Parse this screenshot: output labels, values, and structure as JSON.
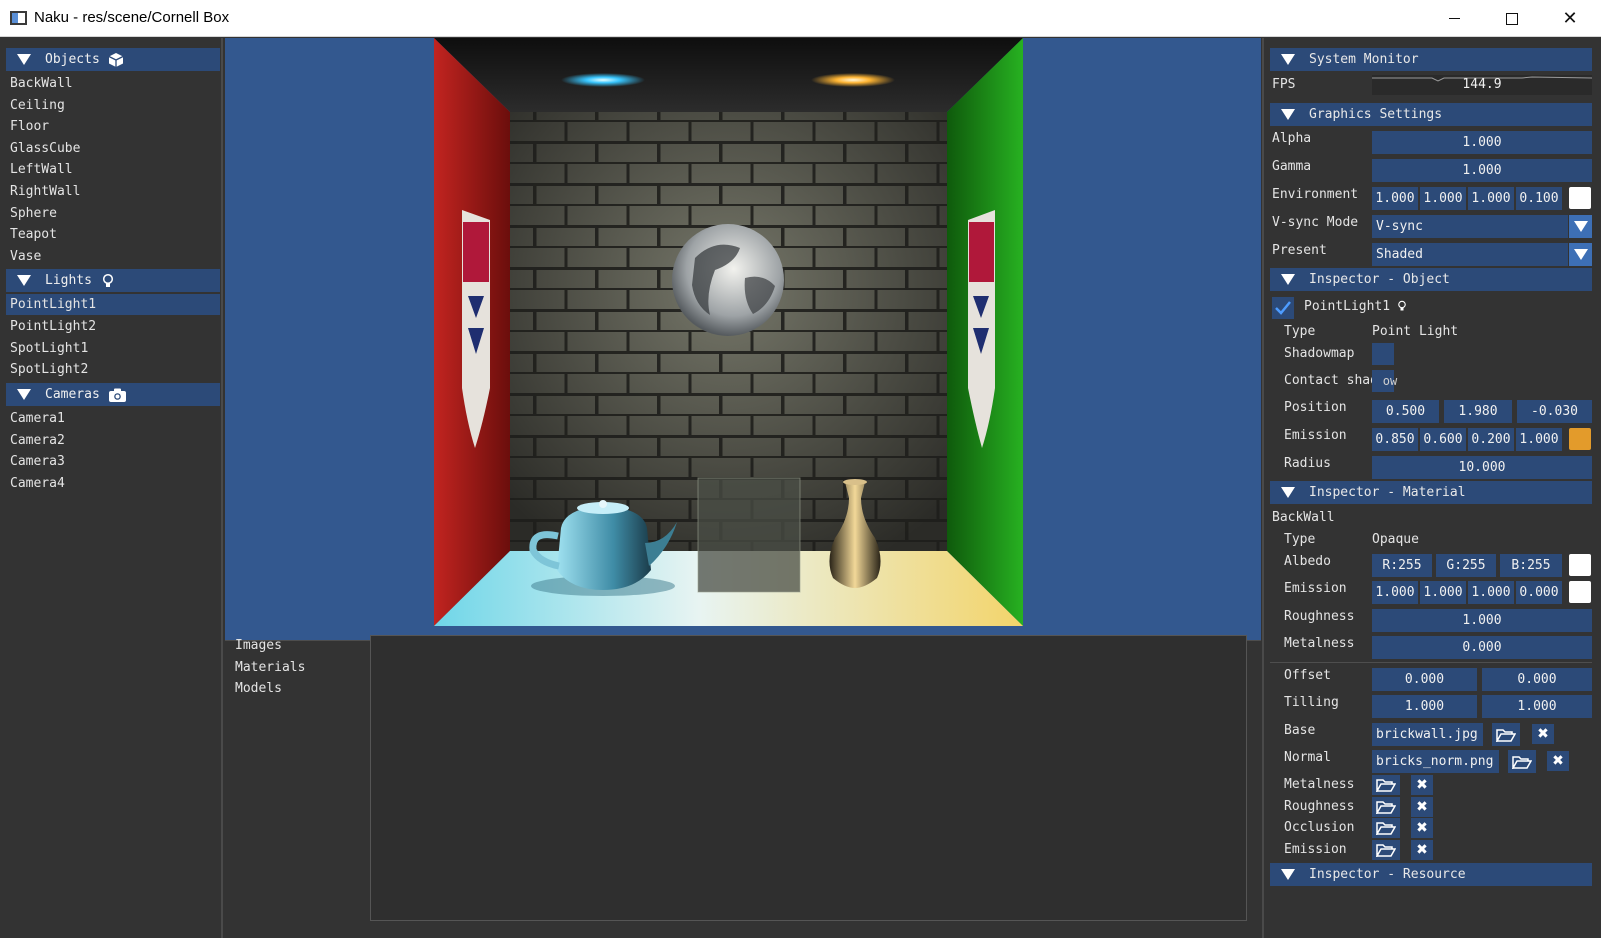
{
  "window": {
    "title": "Naku - res/scene/Cornell Box",
    "minimize_icon": "minimize-icon",
    "maximize_icon": "maximize-icon",
    "close_icon": "close-icon",
    "close_glyph": "✕"
  },
  "scene": {
    "objects_header": "Objects",
    "objects_icon": "cube-icon",
    "objects": [
      "BackWall",
      "Ceiling",
      "Floor",
      "GlassCube",
      "LeftWall",
      "RightWall",
      "Sphere",
      "Teapot",
      "Vase"
    ],
    "lights_header": "Lights",
    "lights_icon": "lightbulb-icon",
    "lights": [
      "PointLight1",
      "PointLight2",
      "SpotLight1",
      "SpotLight2"
    ],
    "selected_light": "PointLight1",
    "cameras_header": "Cameras",
    "cameras_icon": "camera-icon",
    "cameras": [
      "Camera1",
      "Camera2",
      "Camera3",
      "Camera4"
    ]
  },
  "resources": {
    "items": [
      "Images",
      "Materials",
      "Models"
    ]
  },
  "system_monitor": {
    "header": "System Monitor",
    "fps_label": "FPS",
    "fps_value": "144.9"
  },
  "graphics": {
    "header": "Graphics Settings",
    "alpha_label": "Alpha",
    "alpha": "1.000",
    "gamma_label": "Gamma",
    "gamma": "1.000",
    "environment_label": "Environment",
    "environment": [
      "1.000",
      "1.000",
      "1.000",
      "0.100"
    ],
    "vsync_label": "V-sync Mode",
    "vsync_value": "V-sync",
    "present_label": "Present",
    "present_value": "Shaded"
  },
  "inspector_object": {
    "header": "Inspector - Object",
    "name": "PointLight1",
    "enabled_icon": "checkmark-icon",
    "type_label": "Type",
    "type_value": "Point Light",
    "shadowmap_label": "Shadowmap",
    "contact_shadow_label": "Contact shad",
    "contact_shadow_overflow": "ow",
    "position_label": "Position",
    "position": [
      "0.500",
      "1.980",
      "-0.030"
    ],
    "emission_label": "Emission",
    "emission": [
      "0.850",
      "0.600",
      "0.200",
      "1.000"
    ],
    "emission_color": "#e39b2b",
    "radius_label": "Radius",
    "radius": "10.000"
  },
  "inspector_material": {
    "header": "Inspector - Material",
    "name": "BackWall",
    "type_label": "Type",
    "type_value": "Opaque",
    "albedo_label": "Albedo",
    "albedo": [
      "R:255",
      "G:255",
      "B:255"
    ],
    "emission_label": "Emission",
    "emission": [
      "1.000",
      "1.000",
      "1.000",
      "0.000"
    ],
    "roughness_label": "Roughness",
    "roughness": "1.000",
    "metalness_label": "Metalness",
    "metalness": "0.000",
    "offset_label": "Offset",
    "offset": [
      "0.000",
      "0.000"
    ],
    "tilling_label": "Tilling",
    "tilling": [
      "1.000",
      "1.000"
    ],
    "base_label": "Base",
    "base_file": "brickwall.jpg",
    "normal_label": "Normal",
    "normal_file": "bricks_norm.png",
    "metalness_map_label": "Metalness",
    "roughness_map_label": "Roughness",
    "occlusion_map_label": "Occlusion",
    "emission_map_label": "Emission",
    "open_icon": "folder-open-icon",
    "clear_icon": "clear-icon",
    "clear_glyph": "✖"
  },
  "inspector_resource": {
    "header": "Inspector - Resource"
  },
  "colors": {
    "header_bg": "#2c4a78",
    "panel_bg": "#333333",
    "viewport_bg": "#33588f",
    "left_wall": "#b3201c",
    "right_wall": "#1f9a1a"
  }
}
